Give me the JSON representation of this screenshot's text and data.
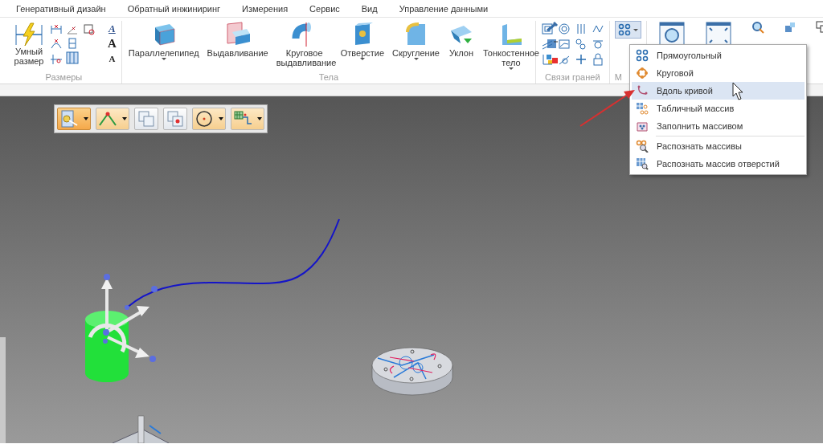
{
  "menu_tabs": [
    {
      "label": "Генеративный дизайн"
    },
    {
      "label": "Обратный инжиниринг"
    },
    {
      "label": "Измерения"
    },
    {
      "label": "Сервис"
    },
    {
      "label": "Вид"
    },
    {
      "label": "Управление данными"
    }
  ],
  "ribbon": {
    "dimensions": {
      "smart_button": {
        "label": "Умный размер"
      },
      "format_glyphs": [
        {
          "glyph": "A",
          "kind": "style"
        },
        {
          "glyph": "A",
          "kind": "grow"
        },
        {
          "glyph": "A",
          "kind": "shrink"
        }
      ],
      "group_label": "Размеры"
    },
    "solids": {
      "buttons": [
        {
          "label": "Параллелепипед",
          "dropdown": true
        },
        {
          "label": "Выдавливание",
          "dropdown": false
        },
        {
          "label": "Круговое выдавливание",
          "dropdown": false
        },
        {
          "label": "Отверстие",
          "dropdown": true
        },
        {
          "label": "Скругление",
          "dropdown": true
        },
        {
          "label": "Уклон",
          "dropdown": false
        },
        {
          "label": "Тонкостенное тело",
          "dropdown": true
        }
      ],
      "group_label": "Тела"
    },
    "face_relations": {
      "group_label": "Связи граней"
    },
    "pattern": {
      "group_label": "М",
      "expanded": true
    }
  },
  "pattern_menu": [
    {
      "label": "Прямоугольный",
      "selected": false
    },
    {
      "label": "Круговой",
      "selected": false
    },
    {
      "label": "Вдоль кривой",
      "selected": true
    },
    {
      "label": "Табличный массив",
      "selected": false
    },
    {
      "label": "Заполнить массивом",
      "selected": false,
      "separator_after": true
    },
    {
      "label": "Распознать массивы",
      "selected": false
    },
    {
      "label": "Распознать массив отверстий",
      "selected": false
    }
  ],
  "floating_toolbar": [
    {
      "selected": true,
      "dropdown": true
    },
    {
      "selected": false,
      "dropdown": true
    },
    {
      "selected": false,
      "dropdown": false
    },
    {
      "selected": false,
      "dropdown": false
    },
    {
      "selected": false,
      "dropdown": true
    },
    {
      "selected": false,
      "dropdown": true
    }
  ]
}
